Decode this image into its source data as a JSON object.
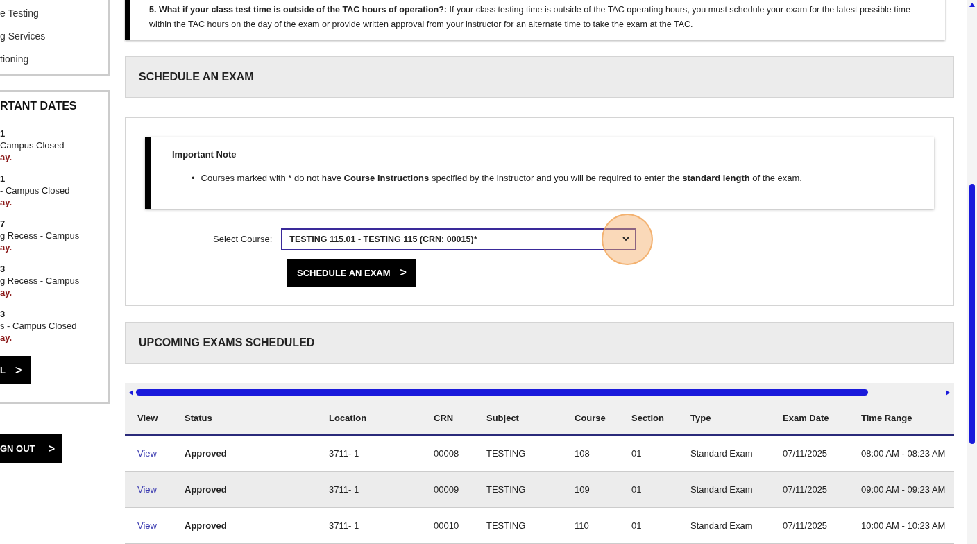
{
  "sidebar": {
    "links": [
      "e Testing",
      "g Services",
      "tioning"
    ],
    "dates_title": "RTANT DATES",
    "dates": [
      {
        "date": "1",
        "desc": "Campus Closed",
        "note": "ay."
      },
      {
        "date": "1",
        "desc": "- Campus Closed",
        "note": "ay."
      },
      {
        "date": "7",
        "desc": "g Recess - Campus",
        "note": "ay."
      },
      {
        "date": "3",
        "desc": "g Recess - Campus",
        "note": "ay."
      },
      {
        "date": "3",
        "desc": "s - Campus Closed",
        "note": "ay."
      }
    ],
    "all_button": "L",
    "sign_out_button": "GN OUT",
    "button_icon": ">"
  },
  "faq": {
    "segments": [
      {
        "text": "5. What if your class test time is outside of the TAC hours of operation?:",
        "kind": "strong"
      },
      {
        "text": " If your class testing time is outside of the TAC operating hours, you must schedule your exam for the latest possible time within the TAC hours on the day of the exam or provide written approval from your instructor for an alternate time to take the exam at the TAC.",
        "kind": "normal"
      }
    ]
  },
  "schedule_section": {
    "title": "SCHEDULE AN EXAM"
  },
  "note": {
    "title": "Important Note",
    "bullet": "•",
    "segments": [
      {
        "text": "Courses marked with * do not have ",
        "kind": "normal"
      },
      {
        "text": "Course Instructions",
        "kind": "strong"
      },
      {
        "text": " specified by the instructor and you will be required to enter the ",
        "kind": "normal"
      },
      {
        "text": "standard length",
        "kind": "term"
      },
      {
        "text": " of the exam.",
        "kind": "normal"
      }
    ]
  },
  "course_select": {
    "label": "Select Course:",
    "value": "TESTING 115.01 - TESTING 115 (CRN: 00015)*"
  },
  "schedule_button": "SCHEDULE AN EXAM",
  "upcoming_section": {
    "title": "UPCOMING EXAMS SCHEDULED"
  },
  "table": {
    "columns": [
      "View",
      "Status",
      "Location",
      "CRN",
      "Subject",
      "Course",
      "Section",
      "Type",
      "Exam Date",
      "Time Range"
    ],
    "rows": [
      {
        "view": "View",
        "status": "Approved",
        "location": "3711- 1",
        "crn": "00008",
        "subject": "TESTING",
        "course": "108",
        "section": "01",
        "type": "Standard Exam",
        "exam_date": "07/11/2025",
        "time_range": "08:00 AM - 08:23 AM"
      },
      {
        "view": "View",
        "status": "Approved",
        "location": "3711- 1",
        "crn": "00009",
        "subject": "TESTING",
        "course": "109",
        "section": "01",
        "type": "Standard Exam",
        "exam_date": "07/11/2025",
        "time_range": "09:00 AM - 09:23 AM"
      },
      {
        "view": "View",
        "status": "Approved",
        "location": "3711- 1",
        "crn": "00010",
        "subject": "TESTING",
        "course": "110",
        "section": "01",
        "type": "Standard Exam",
        "exam_date": "07/11/2025",
        "time_range": "10:00 AM - 10:23 AM"
      }
    ]
  }
}
